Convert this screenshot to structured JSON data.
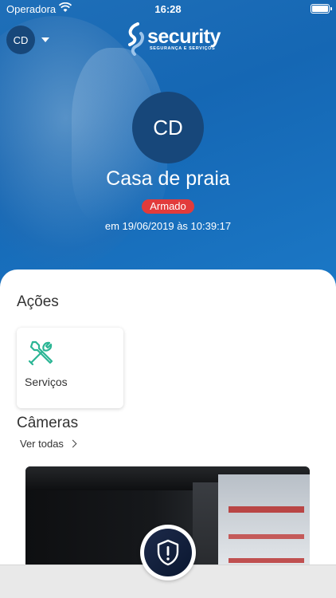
{
  "status_bar": {
    "carrier": "Operadora",
    "time": "16:28"
  },
  "account": {
    "initials": "CD"
  },
  "brand": {
    "name": "security",
    "tagline": "SEGURANÇA E SERVIÇOS",
    "color": "#1567b4"
  },
  "site": {
    "initials": "CD",
    "name": "Casa de praia",
    "status": "Armado",
    "status_color": "#e23b3b",
    "armed_time": "em 19/06/2019 às 10:39:17"
  },
  "actions": {
    "title": "Ações",
    "items": [
      {
        "label": "Serviços",
        "icon": "tools-icon",
        "icon_color": "#2bb594"
      }
    ]
  },
  "cameras": {
    "title": "Câmeras",
    "see_all": "Ver todas"
  },
  "panic_button": {
    "icon": "shield-alert-icon"
  }
}
